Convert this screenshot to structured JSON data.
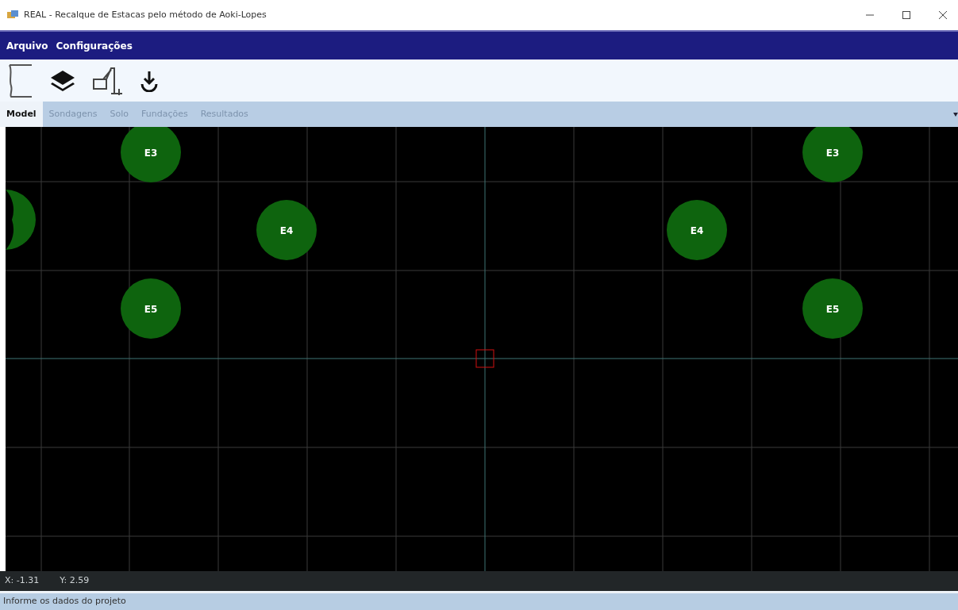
{
  "window": {
    "title": "REAL - Recalque de Estacas pelo método de Aoki-Lopes"
  },
  "menu": [
    "Arquivo",
    "Configurações"
  ],
  "tabs": [
    {
      "label": "Model",
      "selected": true
    },
    {
      "label": "Sondagens",
      "selected": false
    },
    {
      "label": "Solo",
      "selected": false
    },
    {
      "label": "Fundações",
      "selected": false
    },
    {
      "label": "Resultados",
      "selected": false
    }
  ],
  "canvas": {
    "piles": [
      {
        "label": "E3"
      },
      {
        "label": "E4"
      },
      {
        "label": "E5"
      },
      {
        "label": "E3"
      },
      {
        "label": "E4"
      },
      {
        "label": "E5"
      }
    ]
  },
  "coordinates": {
    "x": "X: -1.31",
    "y": "Y: 2.59"
  },
  "status_bar": "Informe os dados do projeto"
}
